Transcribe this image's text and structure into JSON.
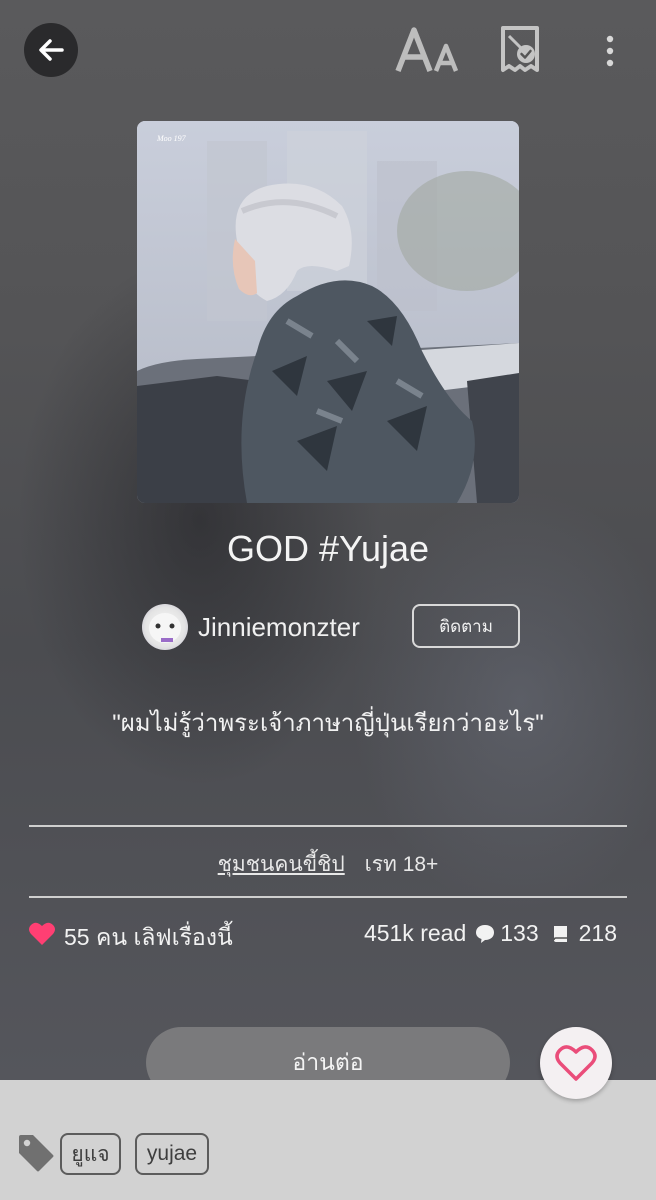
{
  "story": {
    "title": "GOD #Yujae",
    "author": "Jinniemonzter",
    "follow_label": "ติดตาม",
    "quote": "\"ผมไม่รู้ว่าพระเจ้าภาษาญี่ปุ่นเรียกว่าอะไร\"",
    "category": "ชุมชนคนขี้ชิป",
    "rating": "เรท 18+",
    "loves": "55 คน เลิฟเรื่องนี้",
    "reads": "451k read",
    "comments": "133",
    "chapters": "218"
  },
  "actions": {
    "read_label": "อ่านต่อ"
  },
  "tags": [
    "ยูแจ",
    "yujae"
  ],
  "colors": {
    "heart": "#ff3f73",
    "fav_heart": "#ea4d7a",
    "read_button": "#7a7a7c",
    "bottom_bar": "#d2d2d2"
  },
  "icons": [
    "back-arrow-icon",
    "font-size-icon",
    "bookmark-check-icon",
    "more-vertical-icon",
    "heart-icon",
    "comment-icon",
    "book-icon",
    "tag-icon"
  ]
}
